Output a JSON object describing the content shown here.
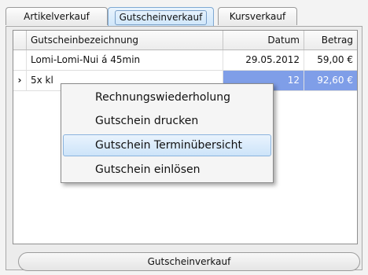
{
  "tabs": [
    {
      "label": "Artikelverkauf"
    },
    {
      "label": "Gutscheinverkauf"
    },
    {
      "label": "Kursverkauf"
    }
  ],
  "table": {
    "columns": [
      "Gutscheinbezeichnung",
      "Datum",
      "Betrag"
    ],
    "rows": [
      {
        "indicator": "",
        "name": "Lomi-Lomi-Nui á 45min",
        "date": "29.05.2012",
        "amount": "59,00 €"
      },
      {
        "indicator": "›",
        "name": "5x kl",
        "date": "12",
        "amount": "92,60 €"
      }
    ]
  },
  "context_menu": {
    "items": [
      {
        "label": "Rechnungswiederholung"
      },
      {
        "label": "Gutschein drucken"
      },
      {
        "label": "Gutschein Terminübersicht"
      },
      {
        "label": "Gutschein einlösen"
      }
    ]
  },
  "bottom_button": {
    "label": "Gutscheinverkauf"
  },
  "colors": {
    "selection": "#7f9ee8",
    "menu_highlight": "#cde4f9"
  }
}
